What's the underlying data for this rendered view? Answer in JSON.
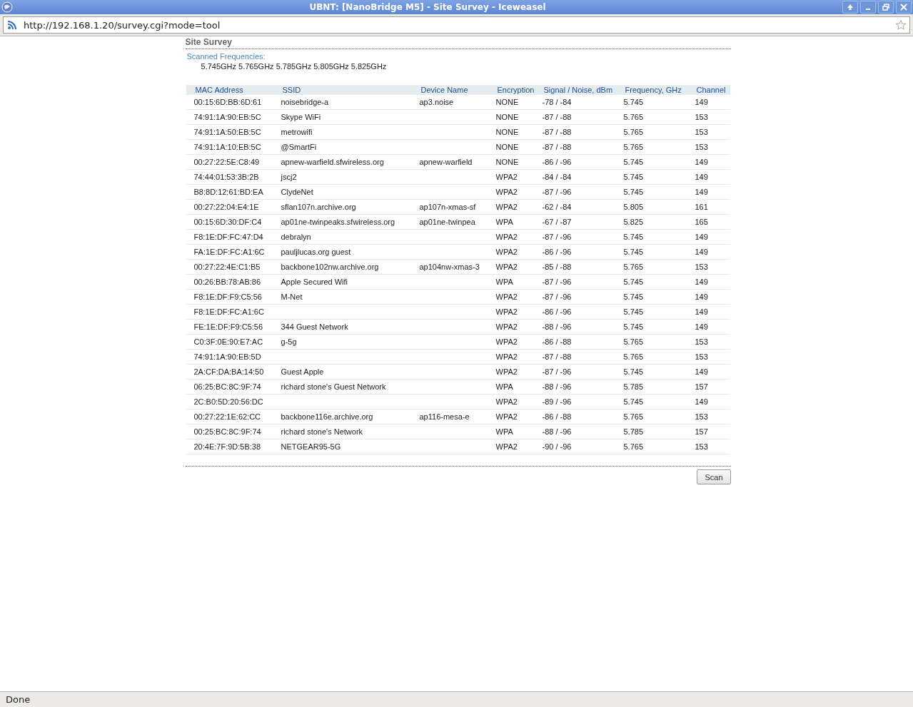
{
  "window": {
    "title": "UBNT: [NanoBridge M5] - Site Survey - Iceweasel"
  },
  "address_bar": {
    "url": "http://192.168.1.20/survey.cgi?mode=tool"
  },
  "page": {
    "heading": "Site Survey",
    "scanned_label": "Scanned Frequencies:",
    "frequencies": "5.745GHz 5.765GHz 5.785GHz 5.805GHz 5.825GHz"
  },
  "table": {
    "columns": [
      "MAC Address",
      "SSID",
      "Device Name",
      "Encryption",
      "Signal / Noise, dBm",
      "Frequency, GHz",
      "Channel"
    ],
    "rows": [
      {
        "mac": "00:15:6D:BB:6D:61",
        "ssid": "noisebridge-a",
        "device": "ap3.noise",
        "encryption": "NONE",
        "signal_noise": "-78 / -84",
        "frequency": "5.745",
        "channel": "149"
      },
      {
        "mac": "74:91:1A:90:EB:5C",
        "ssid": "Skype WiFi",
        "encryption": "NONE",
        "signal_noise": "-87 / -88",
        "frequency": "5.765",
        "channel": "153"
      },
      {
        "mac": "74:91:1A:50:EB:5C",
        "ssid": "metrowifi",
        "encryption": "NONE",
        "signal_noise": "-87 / -88",
        "frequency": "5.765",
        "channel": "153"
      },
      {
        "mac": "74:91:1A:10:EB:5C",
        "ssid": "@SmartFi",
        "encryption": "NONE",
        "signal_noise": "-87 / -88",
        "frequency": "5.765",
        "channel": "153"
      },
      {
        "mac": "00:27:22:5E:C8:49",
        "ssid": "apnew-warfield.sfwireless.org",
        "device": "apnew-warfield",
        "encryption": "NONE",
        "signal_noise": "-86 / -96",
        "frequency": "5.745",
        "channel": "149"
      },
      {
        "mac": "74:44:01:53:3B:2B",
        "ssid": "jscj2",
        "encryption": "WPA2",
        "signal_noise": "-84 / -84",
        "frequency": "5.745",
        "channel": "149"
      },
      {
        "mac": "B8:8D:12:61:BD:EA",
        "ssid": "ClydeNet",
        "encryption": "WPA2",
        "signal_noise": "-87 / -96",
        "frequency": "5.745",
        "channel": "149"
      },
      {
        "mac": "00:27:22:04:E4:1E",
        "ssid": "sflan107n.archive.org",
        "device": "ap107n-xmas-sf",
        "encryption": "WPA2",
        "signal_noise": "-62 / -84",
        "frequency": "5.805",
        "channel": "161"
      },
      {
        "mac": "00:15:6D:30:DF:C4",
        "ssid": "ap01ne-twinpeaks.sfwireless.org",
        "device": "ap01ne-twinpea",
        "encryption": "WPA",
        "signal_noise": "-67 / -87",
        "frequency": "5.825",
        "channel": "165"
      },
      {
        "mac": "F8:1E:DF:FC:47:D4",
        "ssid": "debralyn",
        "encryption": "WPA2",
        "signal_noise": "-87 / -96",
        "frequency": "5.745",
        "channel": "149"
      },
      {
        "mac": "FA:1E:DF:FC:A1:6C",
        "ssid": "pauljlucas.org guest",
        "encryption": "WPA2",
        "signal_noise": "-86 / -96",
        "frequency": "5.745",
        "channel": "149"
      },
      {
        "mac": "00:27:22:4E:C1:B5",
        "ssid": "backbone102nw.archive.org",
        "device": "ap104nw-xmas-3",
        "encryption": "WPA2",
        "signal_noise": "-85 / -88",
        "frequency": "5.765",
        "channel": "153"
      },
      {
        "mac": "00:26:BB:78:AB:86",
        "ssid": "Apple Secured Wifi",
        "encryption": "WPA",
        "signal_noise": "-87 / -96",
        "frequency": "5.745",
        "channel": "149"
      },
      {
        "mac": "F8:1E:DF:F9:C5:56",
        "ssid": "M-Net",
        "encryption": "WPA2",
        "signal_noise": "-87 / -96",
        "frequency": "5.745",
        "channel": "149"
      },
      {
        "mac": "F8:1E:DF:FC:A1:6C",
        "encryption": "WPA2",
        "signal_noise": "-86 / -96",
        "frequency": "5.745",
        "channel": "149"
      },
      {
        "mac": "FE:1E:DF:F9:C5:56",
        "ssid": "344 Guest Network",
        "encryption": "WPA2",
        "signal_noise": "-88 / -96",
        "frequency": "5.745",
        "channel": "149"
      },
      {
        "mac": "C0:3F:0E:90:E7:AC",
        "ssid": "g-5g",
        "encryption": "WPA2",
        "signal_noise": "-86 / -88",
        "frequency": "5.765",
        "channel": "153"
      },
      {
        "mac": "74:91:1A:90:EB:5D",
        "encryption": "WPA2",
        "signal_noise": "-87 / -88",
        "frequency": "5.765",
        "channel": "153"
      },
      {
        "mac": "2A:CF:DA:BA:14:50",
        "ssid": "Guest Apple",
        "encryption": "WPA2",
        "signal_noise": "-87 / -96",
        "frequency": "5.745",
        "channel": "149"
      },
      {
        "mac": "06:25:BC:8C:9F:74",
        "ssid": "richard stone's Guest Network",
        "encryption": "WPA",
        "signal_noise": "-88 / -96",
        "frequency": "5.785",
        "channel": "157"
      },
      {
        "mac": "2C:B0:5D:20:56:DC",
        "encryption": "WPA2",
        "signal_noise": "-89 / -96",
        "frequency": "5.745",
        "channel": "149"
      },
      {
        "mac": "00:27:22:1E:62:CC",
        "ssid": "backbone116e.archive.org",
        "device": "ap116-mesa-e",
        "encryption": "WPA2",
        "signal_noise": "-86 / -88",
        "frequency": "5.765",
        "channel": "153"
      },
      {
        "mac": "00:25:BC:8C:9F:74",
        "ssid": "richard stone's Network",
        "encryption": "WPA",
        "signal_noise": "-88 / -96",
        "frequency": "5.785",
        "channel": "157"
      },
      {
        "mac": "20:4E:7F:9D:5B:38",
        "ssid": "NETGEAR95-5G",
        "encryption": "WPA2",
        "signal_noise": "-90 / -96",
        "frequency": "5.765",
        "channel": "153"
      }
    ]
  },
  "buttons": {
    "scan": "Scan"
  },
  "status_bar": {
    "text": "Done"
  }
}
